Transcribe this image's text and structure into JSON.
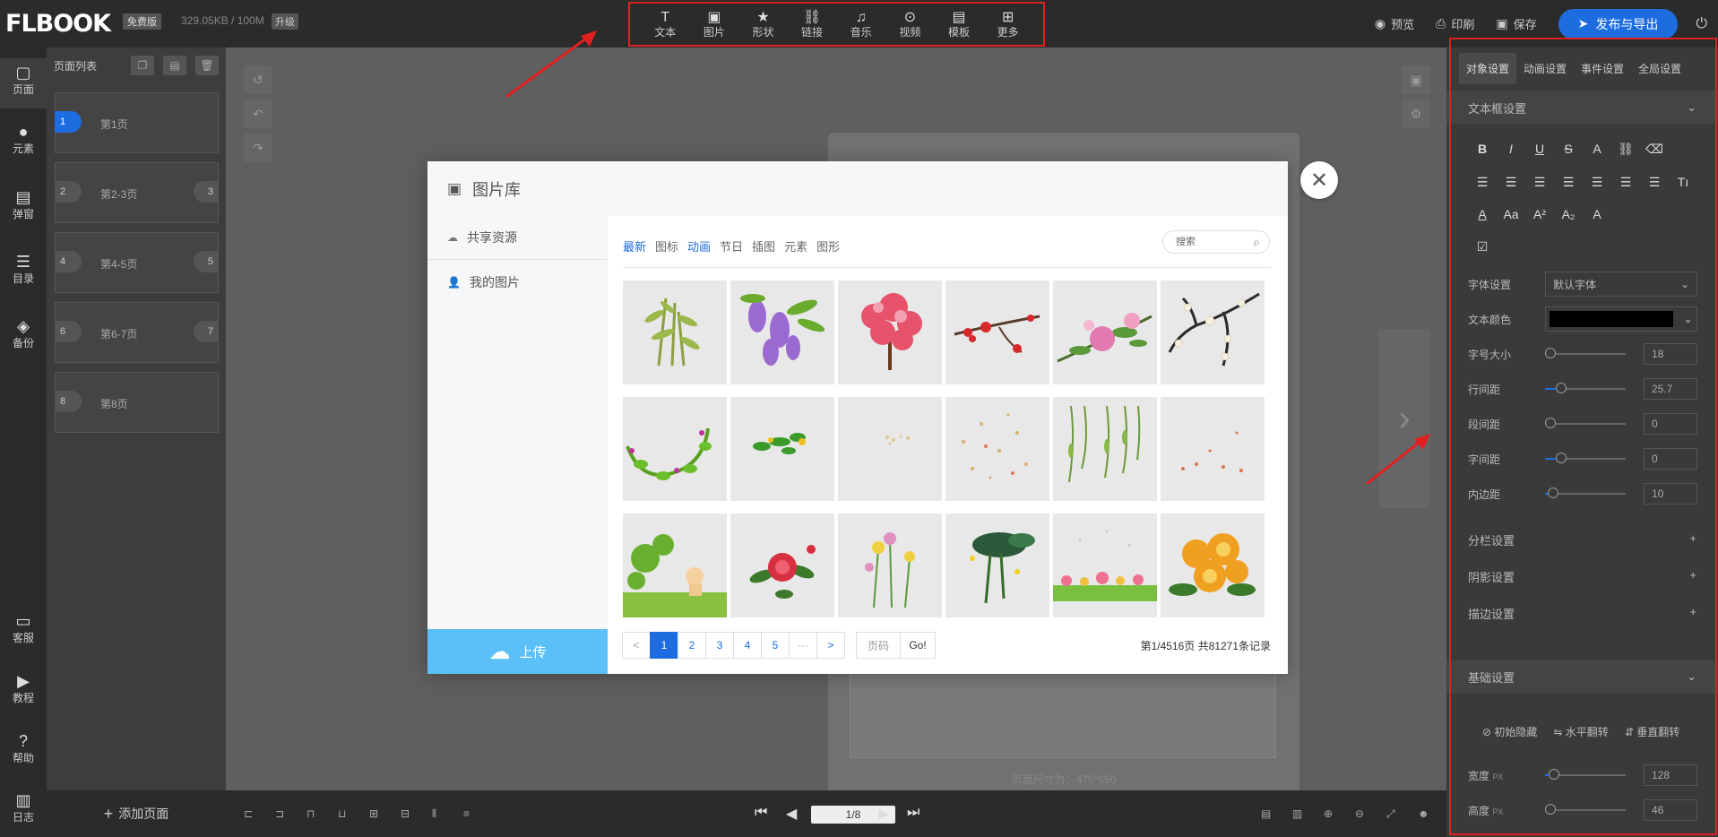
{
  "app": {
    "logo": "FLBOOK",
    "edition_badge": "免费版",
    "storage": "329.05KB / 100M",
    "upgrade": "升级"
  },
  "toolbar": [
    {
      "label": "文本",
      "icon": "text-icon"
    },
    {
      "label": "图片",
      "icon": "image-icon"
    },
    {
      "label": "形状",
      "icon": "star-icon"
    },
    {
      "label": "链接",
      "icon": "link-icon"
    },
    {
      "label": "音乐",
      "icon": "music-icon"
    },
    {
      "label": "视频",
      "icon": "play-icon"
    },
    {
      "label": "模板",
      "icon": "template-icon"
    },
    {
      "label": "更多",
      "icon": "more-icon"
    }
  ],
  "top_right": {
    "preview": "预览",
    "print": "印刷",
    "save": "保存",
    "publish": "发布与导出"
  },
  "left_nav": [
    {
      "label": "页面",
      "icon": "page-icon"
    },
    {
      "label": "元素",
      "icon": "element-icon"
    },
    {
      "label": "弹窗",
      "icon": "popup-icon"
    },
    {
      "label": "目录",
      "icon": "list-icon"
    },
    {
      "label": "备份",
      "icon": "stack-icon"
    },
    {
      "label": "客服",
      "icon": "chat-icon"
    },
    {
      "label": "教程",
      "icon": "tutorial-icon"
    },
    {
      "label": "帮助",
      "icon": "help-icon"
    },
    {
      "label": "日志",
      "icon": "log-icon"
    }
  ],
  "page_list": {
    "title": "页面列表",
    "items": [
      {
        "num": "1",
        "num2": "",
        "label": "第1页"
      },
      {
        "num": "2",
        "num2": "3",
        "label": "第2-3页"
      },
      {
        "num": "4",
        "num2": "5",
        "label": "第4-5页"
      },
      {
        "num": "6",
        "num2": "7",
        "label": "第6-7页"
      },
      {
        "num": "8",
        "num2": "",
        "label": "第8页"
      }
    ],
    "add_page": "添加页面"
  },
  "canvas": {
    "page_size": "页面尺寸为：475*650",
    "page_indicator": "1/8"
  },
  "right_panel": {
    "tabs": [
      "对象设置",
      "动画设置",
      "事件设置",
      "全局设置"
    ],
    "textbox_section": "文本框设置",
    "font_label": "字体设置",
    "font_value": "默认字体",
    "color_label": "文本颜色",
    "color_value": "#000000",
    "props": [
      {
        "label": "字号大小",
        "value": "18",
        "level": 0.05
      },
      {
        "label": "行间距",
        "value": "25.7",
        "level": 0.2
      },
      {
        "label": "段间距",
        "value": "0",
        "level": 0
      },
      {
        "label": "字间距",
        "value": "0",
        "level": 0.2
      },
      {
        "label": "内边距",
        "value": "10",
        "level": 0.1
      }
    ],
    "column_section": "分栏设置",
    "shadow_section": "阴影设置",
    "stroke_section": "描边设置",
    "basic_section": "基础设置",
    "init_hide": "初始隐藏",
    "flip_h": "水平翻转",
    "flip_v": "垂直翻转",
    "width_label": "宽度",
    "height_label": "高度",
    "px_unit": "PX",
    "width_value": "128",
    "height_value": "46"
  },
  "dialog": {
    "title": "图片库",
    "side": [
      "共享资源",
      "我的图片"
    ],
    "upload": "上传",
    "categories": [
      "最新",
      "图标",
      "动画",
      "节日",
      "插图",
      "元素",
      "图形"
    ],
    "active_categories": [
      "最新",
      "动画"
    ],
    "search_placeholder": "搜索",
    "pagination": [
      "<",
      "1",
      "2",
      "3",
      "4",
      "5",
      "···",
      ">"
    ],
    "page_input": "页码",
    "go": "Go!",
    "info": "第1/4516页  共81271条记录"
  },
  "colors": {
    "accent": "#1e6de0",
    "highlight_border": "#e02020",
    "upload": "#5bc0f8"
  }
}
